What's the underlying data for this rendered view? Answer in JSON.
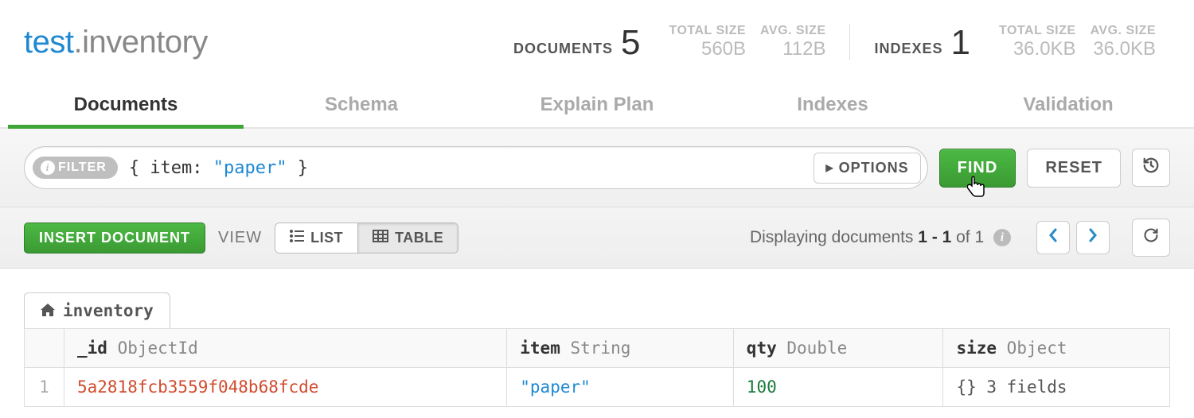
{
  "namespace": {
    "db": "test",
    "dot": ".",
    "collection": "inventory"
  },
  "stats": {
    "documents": {
      "label": "DOCUMENTS",
      "count": "5",
      "total_size_label": "TOTAL SIZE",
      "total_size": "560B",
      "avg_size_label": "AVG. SIZE",
      "avg_size": "112B"
    },
    "indexes": {
      "label": "INDEXES",
      "count": "1",
      "total_size_label": "TOTAL SIZE",
      "total_size": "36.0KB",
      "avg_size_label": "AVG. SIZE",
      "avg_size": "36.0KB"
    }
  },
  "tabs": {
    "documents": "Documents",
    "schema": "Schema",
    "explain": "Explain Plan",
    "indexes": "Indexes",
    "validation": "Validation"
  },
  "query": {
    "filter_pill": "FILTER",
    "filter_open": "{ ",
    "filter_key": "item:",
    "filter_space": " ",
    "filter_value": "\"paper\"",
    "filter_close": " }",
    "options": "OPTIONS",
    "find": "FIND",
    "reset": "RESET"
  },
  "actions": {
    "insert": "INSERT DOCUMENT",
    "view_label": "VIEW",
    "list": "LIST",
    "table": "TABLE",
    "displaying_prefix": "Displaying documents ",
    "displaying_range": "1 - 1",
    "displaying_mid": " of ",
    "displaying_total": "1"
  },
  "breadcrumb": {
    "label": "inventory"
  },
  "table": {
    "columns": {
      "id": {
        "name": "_id",
        "type": "ObjectId"
      },
      "item": {
        "name": "item",
        "type": "String"
      },
      "qty": {
        "name": "qty",
        "type": "Double"
      },
      "size": {
        "name": "size",
        "type": "Object"
      }
    },
    "row": {
      "num": "1",
      "id": "5a2818fcb3559f048b68fcde",
      "item": "\"paper\"",
      "qty": "100",
      "size": "{} 3 fields"
    }
  }
}
